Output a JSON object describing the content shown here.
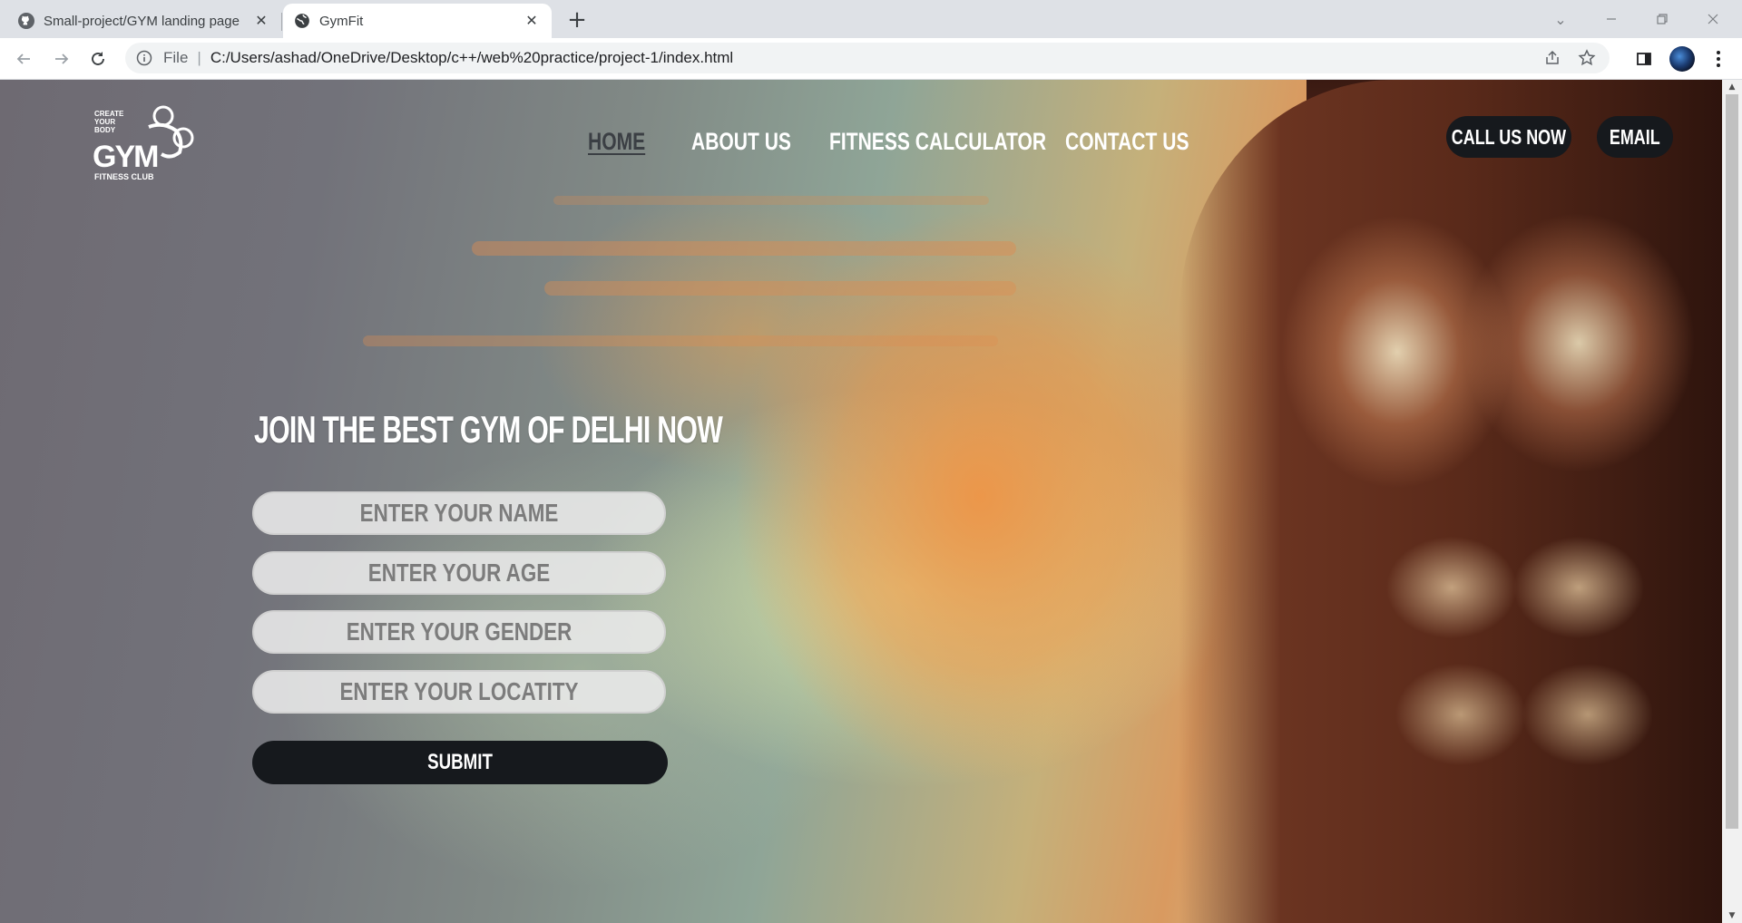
{
  "browser": {
    "tabs": [
      {
        "title": "Small-project/GYM landing page",
        "active": false,
        "favicon": "github-icon"
      },
      {
        "title": "GymFit",
        "active": true,
        "favicon": "globe-icon"
      }
    ],
    "address": {
      "scheme_label": "File",
      "url": "C:/Users/ashad/OneDrive/Desktop/c++/web%20practice/project-1/index.html"
    }
  },
  "site": {
    "logo": {
      "line1": "CREATE",
      "line2": "YOUR",
      "line3": "BODY",
      "mark": "GYM",
      "subtitle": "FITNESS CLUB"
    },
    "nav": [
      {
        "label": "HOME",
        "active": true
      },
      {
        "label": "ABOUT US",
        "active": false
      },
      {
        "label": "FITNESS CALCULATOR",
        "active": false
      },
      {
        "label": "CONTACT US",
        "active": false
      }
    ],
    "actions": {
      "call": "CALL US NOW",
      "email": "EMAIL"
    },
    "hero": {
      "headline": "JOIN THE BEST GYM OF DELHI NOW",
      "fields": {
        "name": "ENTER YOUR NAME",
        "age": "ENTER YOUR AGE",
        "gender": "ENTER YOUR GENDER",
        "locality": "ENTER YOUR LOCATITY"
      },
      "submit": "SUBMIT"
    }
  },
  "colors": {
    "pill_bg": "#16191d",
    "nav_active": "#3b3f44",
    "nav_text": "#ffffff"
  }
}
